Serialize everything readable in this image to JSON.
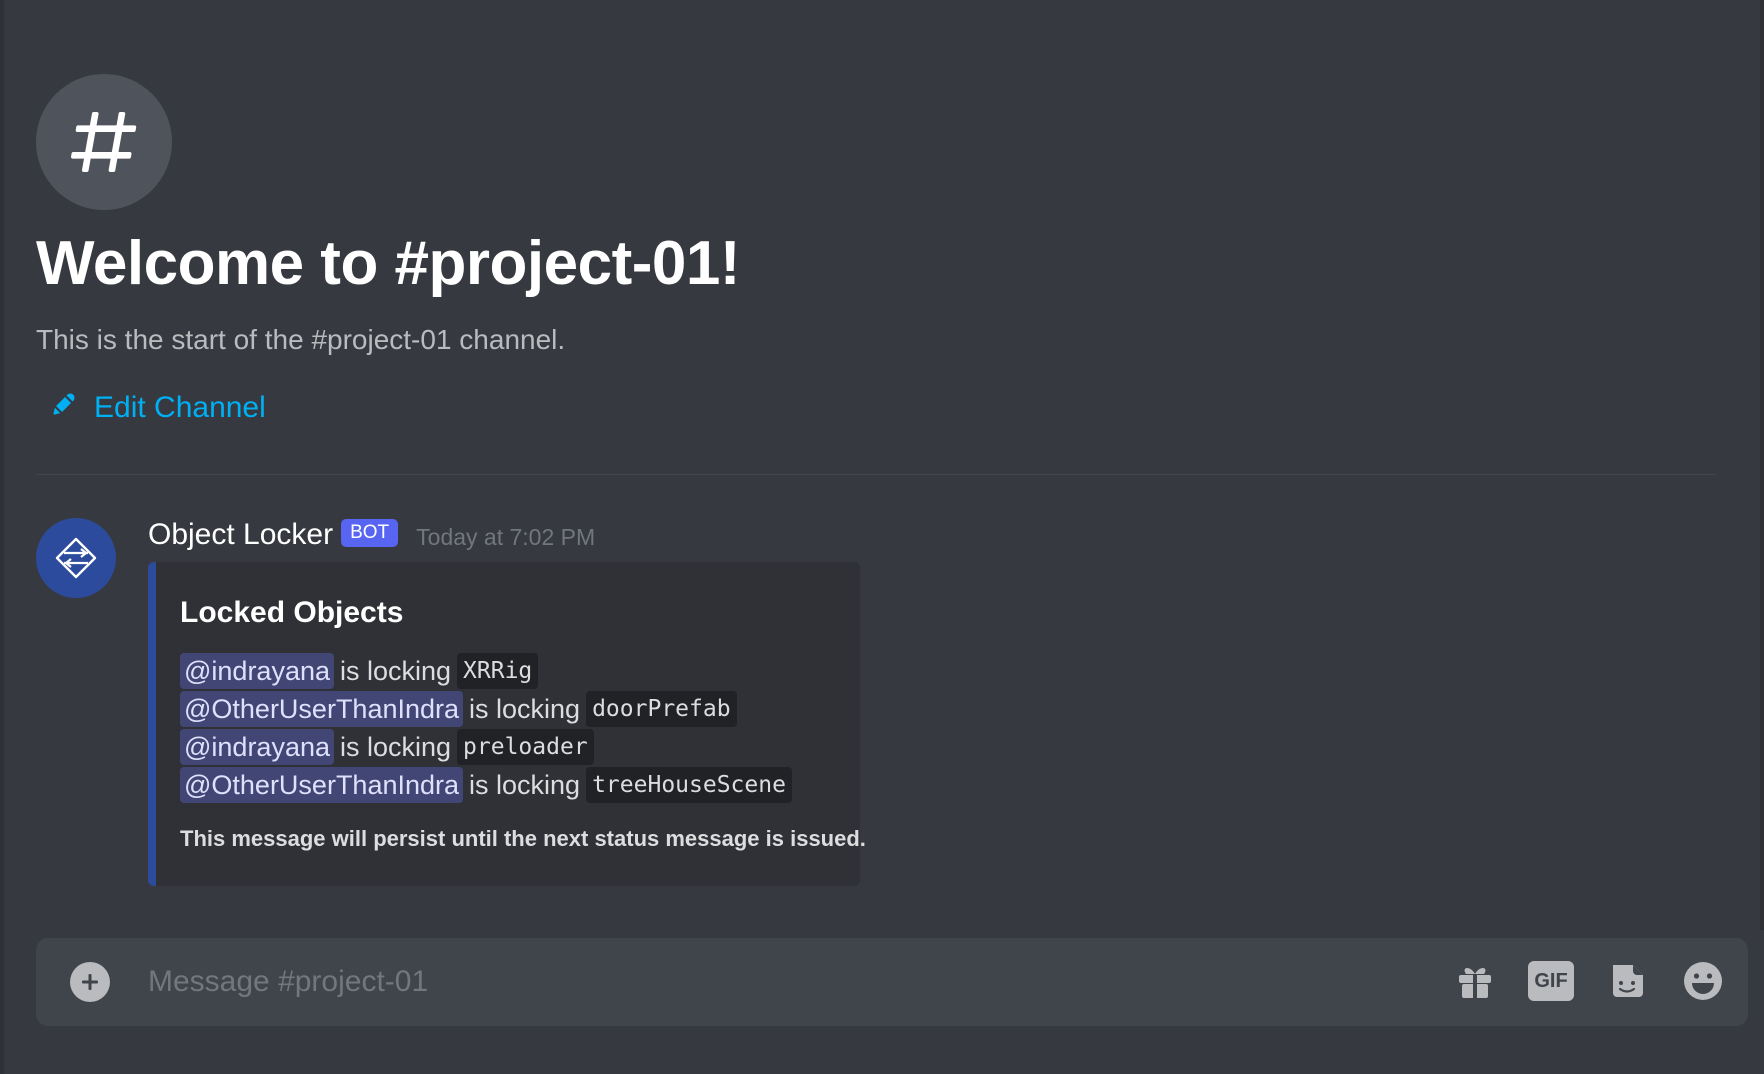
{
  "channel": {
    "icon": "hashtag-icon",
    "welcome_title": "Welcome to #project-01!",
    "welcome_subtitle": "This is the start of the #project-01 channel.",
    "edit_label": "Edit Channel",
    "edit_icon": "pencil-icon"
  },
  "message": {
    "avatar_icon": "object-locker-icon",
    "author": "Object Locker",
    "bot_tag": "BOT",
    "timestamp": "Today at 7:02 PM",
    "embed": {
      "accent_color": "#2c4b9d",
      "title": "Locked Objects",
      "lines": [
        {
          "mention": "@indrayana",
          "verb": "is locking",
          "object": "XRRig"
        },
        {
          "mention": "@OtherUserThanIndra",
          "verb": "is locking",
          "object": "doorPrefab"
        },
        {
          "mention": "@indrayana",
          "verb": "is locking",
          "object": "preloader"
        },
        {
          "mention": "@OtherUserThanIndra",
          "verb": "is locking",
          "object": "treeHouseScene"
        }
      ],
      "footer": "This message will persist until the next status message is issued."
    }
  },
  "composer": {
    "placeholder": "Message #project-01",
    "add_icon": "plus-circle-icon",
    "gift_icon": "gift-icon",
    "gif_label": "GIF",
    "sticker_icon": "sticker-icon",
    "emoji_icon": "emoji-icon"
  },
  "colors": {
    "background": "#36393f",
    "link": "#00b0f4",
    "bot_tag": "#5865f2",
    "mention_bg": "#414675"
  }
}
